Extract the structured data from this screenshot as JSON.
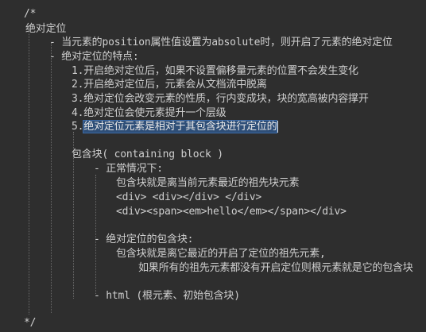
{
  "lines": {
    "open_comment": "/*",
    "title": "绝对定位",
    "bullet_position": "- 当元素的position属性值设置为absolute时，则开启了元素的绝对定位",
    "bullet_features": "- 绝对定位的特点:",
    "feature_1": "1.开启绝对定位后，如果不设置偏移量元素的位置不会发生变化",
    "feature_2": "2.开启绝对定位后，元素会从文档流中脱离",
    "feature_3": "3.绝对定位会改变元素的性质，行内变成块，块的宽高被内容撑开",
    "feature_4": "4.绝对定位会使元素提升一个层级",
    "feature_5_prefix": "5.",
    "feature_5_selected": "绝对定位元素是相对于其包含块进行定位的",
    "containing_block": "包含块( containing block )",
    "normal_case": "- 正常情况下:",
    "normal_desc": "包含块就是离当前元素最近的祖先块元素",
    "example_1": "<div> <div></div> </div>",
    "example_2": "<div><span><em>hello</em></span></div>",
    "abs_block": "- 绝对定位的包含块:",
    "abs_desc_1": "包含块就是离它最近的开启了定位的祖先元素,",
    "abs_desc_2": "如果所有的祖先元素都没有开启定位则根元素就是它的包含块",
    "html_root": "- html (根元素、初始包含块)",
    "close_comment": "*/"
  }
}
